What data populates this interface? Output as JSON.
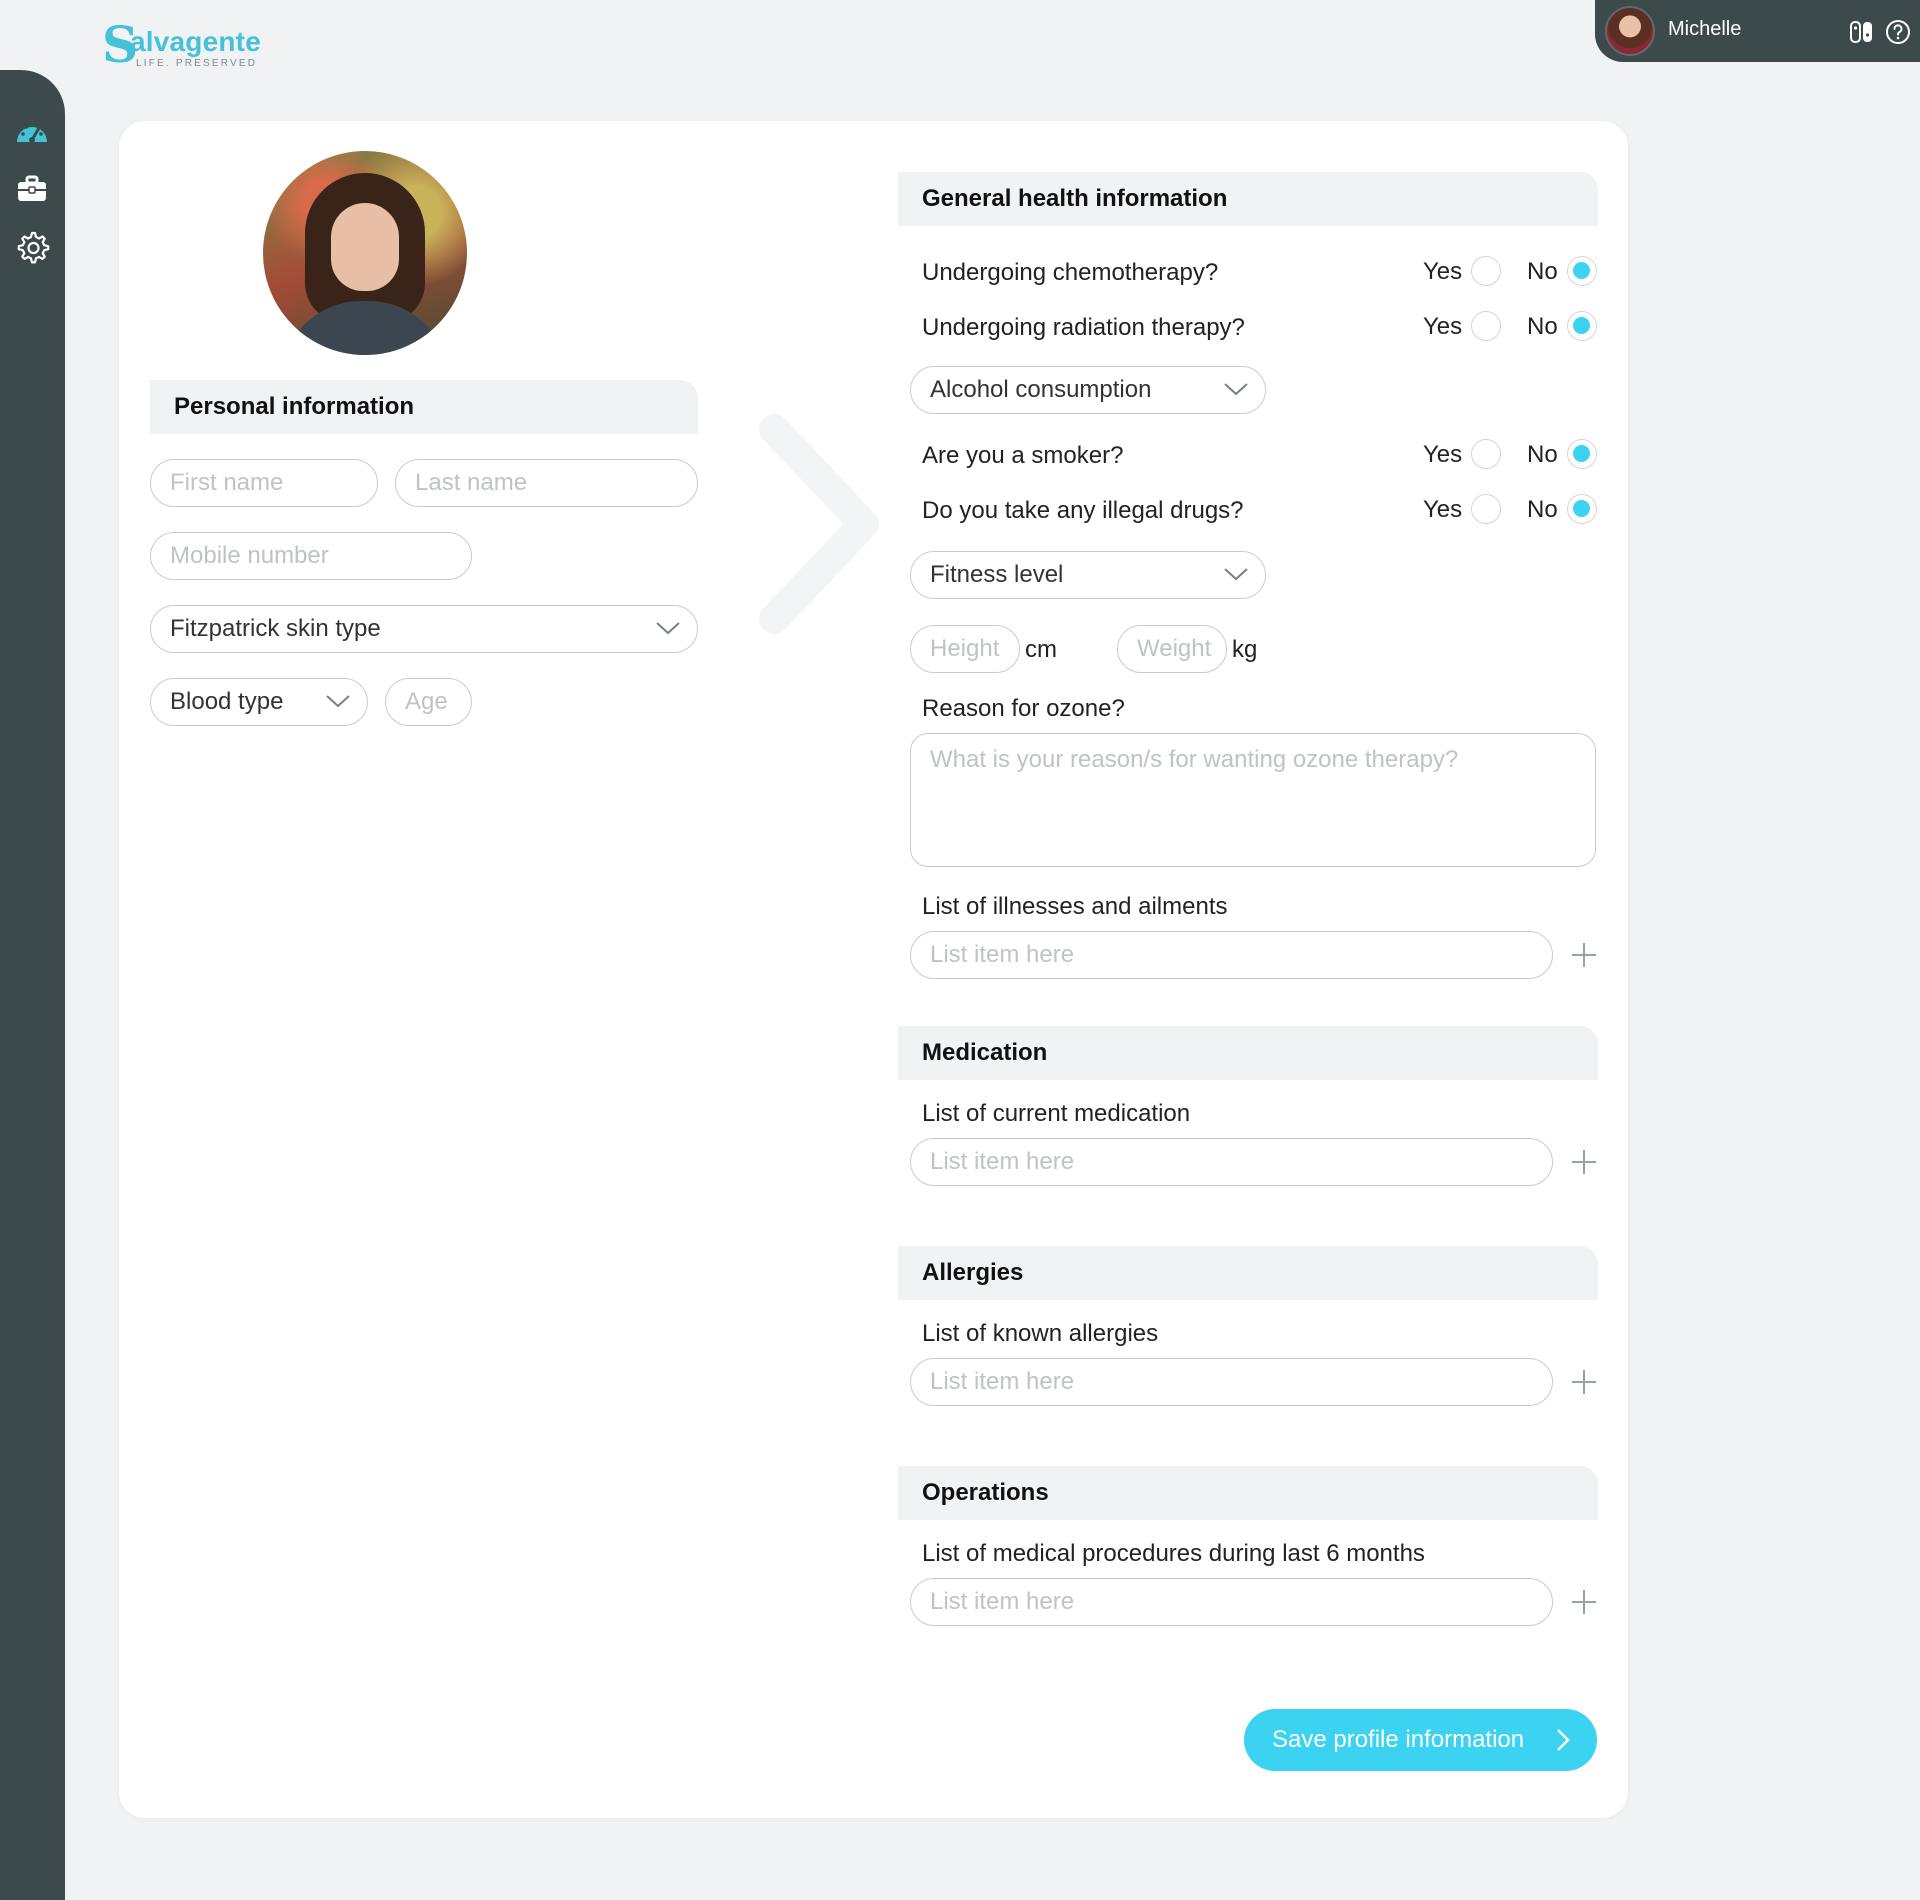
{
  "brand": {
    "mark": "S",
    "word": "alvagente",
    "tagline": "LIFE. PRESERVED"
  },
  "user": {
    "name": "Michelle"
  },
  "sidebar": {
    "items": [
      {
        "icon": "dashboard-gauge-icon"
      },
      {
        "icon": "briefcase-icon"
      },
      {
        "icon": "gear-icon"
      }
    ]
  },
  "personal": {
    "title": "Personal information",
    "first_name_placeholder": "First name",
    "last_name_placeholder": "Last name",
    "mobile_placeholder": "Mobile number",
    "skin_type_label": "Fitzpatrick skin type",
    "blood_type_label": "Blood type",
    "age_placeholder": "Age"
  },
  "health": {
    "title": "General health information",
    "yes_label": "Yes",
    "no_label": "No",
    "questions": [
      {
        "text": "Undergoing chemotherapy?",
        "value": "No"
      },
      {
        "text": "Undergoing radiation therapy?",
        "value": "No"
      },
      {
        "text": "Are you a smoker?",
        "value": "No"
      },
      {
        "text": "Do you take any illegal drugs?",
        "value": "No"
      }
    ],
    "alcohol_label": "Alcohol consumption",
    "fitness_label": "Fitness level",
    "height_placeholder": "Height",
    "height_unit": "cm",
    "weight_placeholder": "Weight",
    "weight_unit": "kg",
    "reason_label": "Reason for ozone?",
    "reason_placeholder": "What is your reason/s for wanting ozone therapy?",
    "illnesses_label": "List of illnesses and ailments",
    "list_placeholder": "List item here"
  },
  "medication": {
    "title": "Medication",
    "label": "List of current medication"
  },
  "allergies": {
    "title": "Allergies",
    "label": "List of known allergies"
  },
  "operations": {
    "title": "Operations",
    "label": "List of medical procedures during last 6 months"
  },
  "actions": {
    "save_label": "Save profile information"
  },
  "colors": {
    "accent": "#3cd2f2",
    "sidebar": "#3d4a4b",
    "brand": "#45c1d8"
  }
}
